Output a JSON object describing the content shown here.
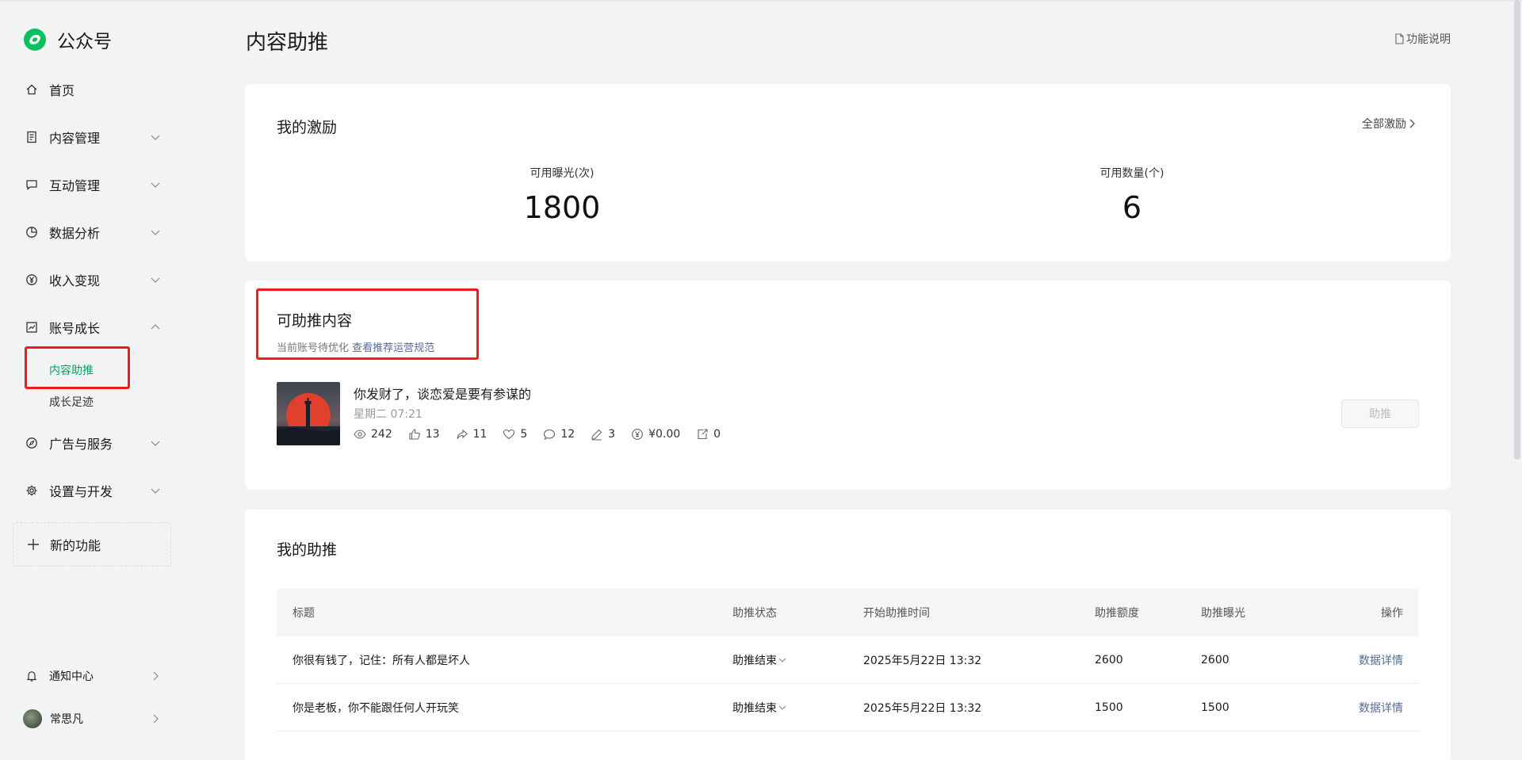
{
  "brand": {
    "name": "公众号"
  },
  "sidebar": {
    "items": [
      {
        "label": "首页",
        "icon": "home-icon"
      },
      {
        "label": "内容管理",
        "icon": "document-icon"
      },
      {
        "label": "互动管理",
        "icon": "chat-icon"
      },
      {
        "label": "数据分析",
        "icon": "pie-chart-icon"
      },
      {
        "label": "收入变现",
        "icon": "yen-icon"
      },
      {
        "label": "账号成长",
        "icon": "trend-icon"
      },
      {
        "label": "广告与服务",
        "icon": "compass-icon"
      },
      {
        "label": "设置与开发",
        "icon": "gear-icon"
      }
    ],
    "growth_sub": [
      "内容助推",
      "成长足迹"
    ],
    "new_feature": "新的功能",
    "notification": "通知中心",
    "user": "常思凡"
  },
  "header": {
    "title": "内容助推",
    "help_link": "功能说明"
  },
  "rewards": {
    "title": "我的激励",
    "all_link": "全部激励",
    "exposure_label": "可用曝光(次)",
    "exposure_value": "1800",
    "count_label": "可用数量(个)",
    "count_value": "6"
  },
  "boostable": {
    "title": "可助推内容",
    "note": "当前账号待优化",
    "note_link": "查看推荐运营规范",
    "article": {
      "title": "你发财了，谈恋爱是要有参谋的",
      "time": "星期二 07:21",
      "reads": "242",
      "likes": "13",
      "shares": "11",
      "favorites": "5",
      "comments": "12",
      "notes": "3",
      "income": "¥0.00",
      "new_followers": "0"
    },
    "button": "助推"
  },
  "my_boosts": {
    "title": "我的助推",
    "columns": [
      "标题",
      "助推状态",
      "开始助推时间",
      "助推额度",
      "助推曝光",
      "操作"
    ],
    "rows": [
      {
        "title": "你很有钱了，记住：所有人都是坏人",
        "status": "助推结束",
        "start": "2025年5月22日 13:32",
        "quota": "2600",
        "exposure": "2600",
        "op": "数据详情"
      },
      {
        "title": "你是老板，你不能跟任何人开玩笑",
        "status": "助推结束",
        "start": "2025年5月22日 13:32",
        "quota": "1500",
        "exposure": "1500",
        "op": "数据详情"
      }
    ]
  },
  "colors": {
    "accent_green": "#07a35a",
    "link_blue": "#576b95",
    "highlight_red": "#f21a1a"
  }
}
